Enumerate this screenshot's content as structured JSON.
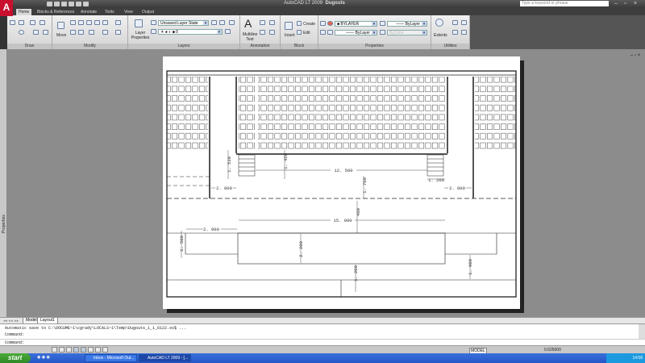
{
  "app": {
    "title": "AutoCAD LT 2009",
    "document": "Dugouts",
    "search_placeholder": "Type a keyword or phrase",
    "logo": "A"
  },
  "ribbon_tabs": [
    "Home",
    "Blocks & References",
    "Annotate",
    "Tools",
    "View",
    "Output"
  ],
  "panels": {
    "draw": {
      "title": "Draw"
    },
    "modify": {
      "title": "Modify",
      "move": "Move"
    },
    "layers": {
      "title": "Layers",
      "layer_properties": "Layer Properties",
      "layer_state": "Unsaved Layer State",
      "current_layer": "0"
    },
    "annotation": {
      "title": "Annotation",
      "multiline_text": "Multiline Text"
    },
    "block": {
      "title": "Block",
      "insert": "Insert",
      "create": "Create",
      "edit": "Edit"
    },
    "properties": {
      "title": "Properties",
      "color": "BYLAYER",
      "lineweight": "ByLayer",
      "linetype": "ByLayer",
      "plotstyle": "ByColor"
    },
    "utilities": {
      "title": "Utilities",
      "extents": "Extents"
    }
  },
  "palette": {
    "label": "Properties"
  },
  "drawing": {
    "dims": [
      "1. 530",
      "1. 450",
      "12. 500",
      "1. 700",
      "1. 200",
      "2. 000",
      "2. 000",
      "400",
      "15. 000",
      "2. 900",
      "1. 500",
      "2. 200",
      "1. 200",
      "1. 900"
    ]
  },
  "layout_tabs": [
    "Model",
    "Layout1"
  ],
  "command": {
    "lines": [
      "Automatic save to C:\\DOCUME~1\\cgrady\\LOCALS~1\\Temp\\Dugouts_1_1_6122.sv$ ...",
      "Command:"
    ],
    "prompt": "Command:"
  },
  "status": {
    "model": "MODEL",
    "scale": "0.625000"
  },
  "taskbar": {
    "start": "start",
    "items": [
      "Inbox - Microsoft Out...",
      "AutoCAD LT 2009 - [..."
    ],
    "clock": "14:58"
  }
}
